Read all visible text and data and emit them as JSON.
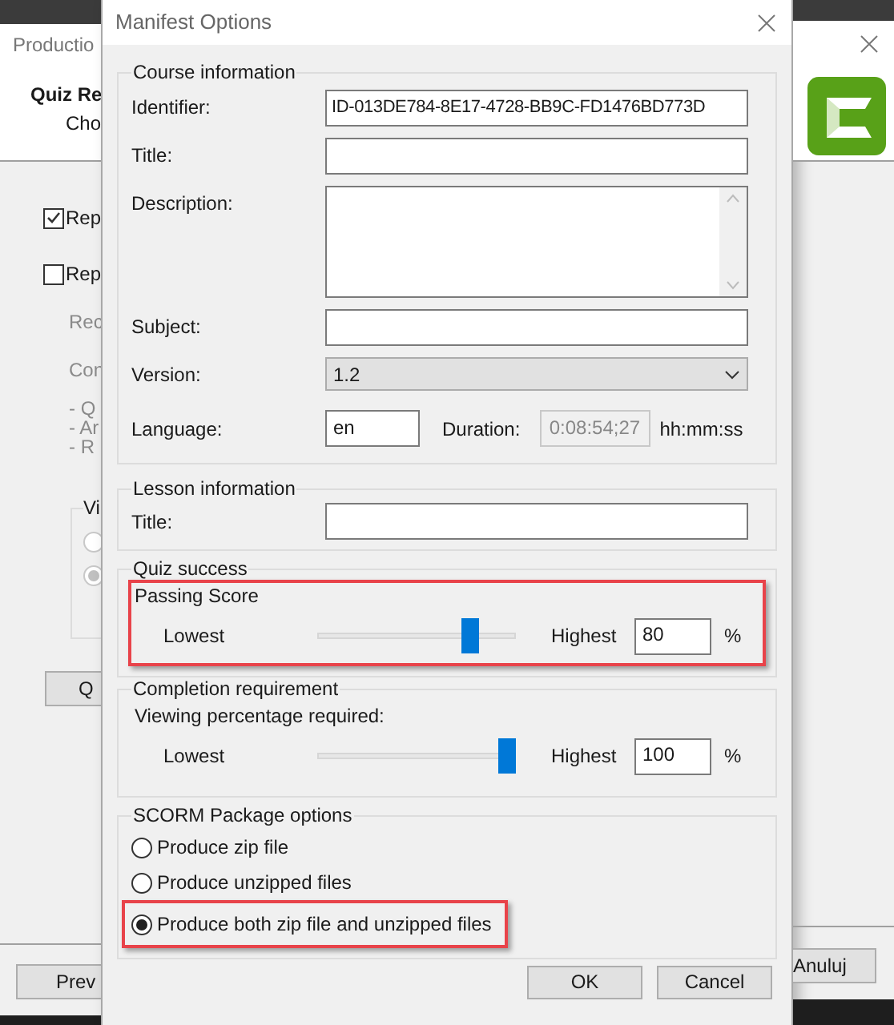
{
  "background_window": {
    "title": "Productio",
    "heading": "Quiz Re",
    "subheading": "Cho",
    "checkboxes": [
      {
        "label": "Rep",
        "checked": true
      },
      {
        "label": "Rep",
        "checked": false
      }
    ],
    "lines": [
      "Rec",
      "Con"
    ],
    "bullets": [
      "- Q",
      "- Ar",
      "- R"
    ],
    "group": {
      "title": "Vi",
      "radios": [
        {
          "selected": false
        },
        {
          "selected": true
        }
      ]
    },
    "button": "Q",
    "left_footer_button": "Prev",
    "right_footer_button": "Anuluj"
  },
  "dialog": {
    "title": "Manifest Options",
    "course": {
      "title": "Course information",
      "fields": [
        {
          "kind": "text",
          "label": "Identifier:",
          "value": "ID-013DE784-8E17-4728-BB9C-FD1476BD773D"
        },
        {
          "kind": "text",
          "label": "Title:"
        },
        {
          "kind": "textarea",
          "label": "Description:"
        },
        {
          "kind": "text",
          "label": "Subject:"
        },
        {
          "kind": "select",
          "label": "Version:",
          "value": "1.2"
        }
      ],
      "language": {
        "label": "Language:",
        "value": "en"
      },
      "duration": {
        "label": "Duration:",
        "value": "0:08:54;27",
        "unit": "hh:mm:ss"
      }
    },
    "lesson": {
      "title": "Lesson information",
      "field_label": "Title:"
    },
    "quiz_success": {
      "title": "Quiz success",
      "subtitle": "Passing Score",
      "min_label": "Lowest",
      "level": 0.8,
      "max_label": "Highest",
      "value": "80",
      "unit": "%",
      "highlighted": true
    },
    "completion": {
      "title": "Completion requirement",
      "subtitle": "Viewing percentage required:",
      "min_label": "Lowest",
      "level": 1,
      "max_label": "Highest",
      "value": "100",
      "unit": "%",
      "highlighted": false
    },
    "scorm": {
      "title": "SCORM Package options",
      "options": [
        {
          "label": "Produce zip file",
          "selected": false,
          "highlighted": false
        },
        {
          "label": "Produce unzipped files",
          "selected": false,
          "highlighted": false
        },
        {
          "label": "Produce both zip file and unzipped files",
          "selected": true,
          "highlighted": true
        }
      ]
    },
    "buttons": [
      "OK",
      "Cancel"
    ]
  }
}
